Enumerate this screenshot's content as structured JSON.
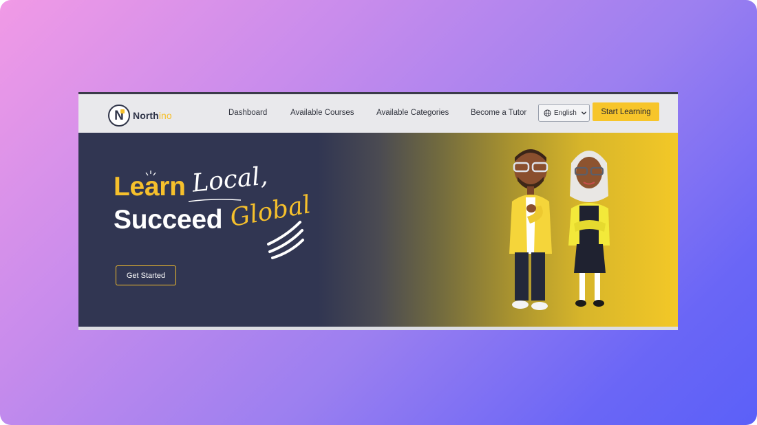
{
  "brand": {
    "name_main": "North",
    "name_accent": "ino",
    "logo_letter": "N"
  },
  "nav": {
    "links": [
      "Dashboard",
      "Available Courses",
      "Available Categories",
      "Become a Tutor"
    ],
    "language": "English",
    "cta_label": "Start Learning"
  },
  "hero": {
    "line1": "Learn",
    "script1": "Local,",
    "line2": "Succeed",
    "script2": "Global",
    "button_label": "Get Started"
  },
  "colors": {
    "accent_yellow": "#f6c02c",
    "hero_navy": "#313652",
    "frame_gradient_start": "#f19ae6",
    "frame_gradient_end": "#5b60f8"
  },
  "icons": {
    "language": "globe-icon",
    "dropdown": "chevron-down-icon"
  }
}
